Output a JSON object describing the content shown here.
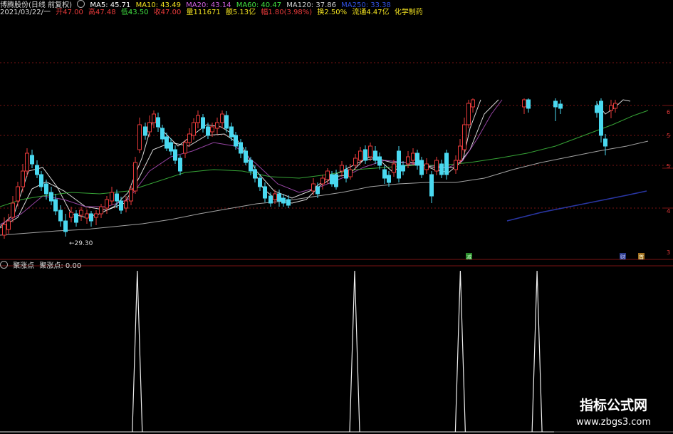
{
  "header": {
    "stock_name": "博腾股份(日线 前复权)",
    "ma5": "MA5: 45.71",
    "ma10": "MA10: 43.49",
    "ma20": "MA20: 43.14",
    "ma60": "MA60: 40.47",
    "ma120": "MA120: 37.86",
    "ma250": "MA250: 33.38",
    "date": "2021/03/22/一",
    "open": "开47.00",
    "high": "高47.48",
    "low": "低43.50",
    "close": "收47.00",
    "volume": "量111671",
    "amount": "额5.13亿",
    "change": "幅1.80(3.98%)",
    "turnover": "换2.50%",
    "float_value": "流通4.47亿",
    "industry": "化学制药"
  },
  "main_chart": {
    "low_label": "←29.30",
    "marker_labels": [
      "减",
      "财",
      "首"
    ],
    "right_ticks": [
      "6",
      "5",
      "5",
      "4",
      "3"
    ]
  },
  "indicator": {
    "name_label": "聚涨点",
    "value_label": "聚涨点: 0.00",
    "spike_positions": [
      0.204,
      0.527,
      0.684,
      0.798
    ]
  },
  "watermark": {
    "title": "指标公式网",
    "url": "www.zbgs3.com"
  },
  "colors": {
    "up": "#e83a3a",
    "down": "#4ad9f0",
    "ma5": "#ffffff",
    "ma10": "#f0e020",
    "ma20": "#b050c0",
    "ma60": "#40c040",
    "ma120": "#c0c0c0",
    "ma250": "#3040c0"
  }
}
